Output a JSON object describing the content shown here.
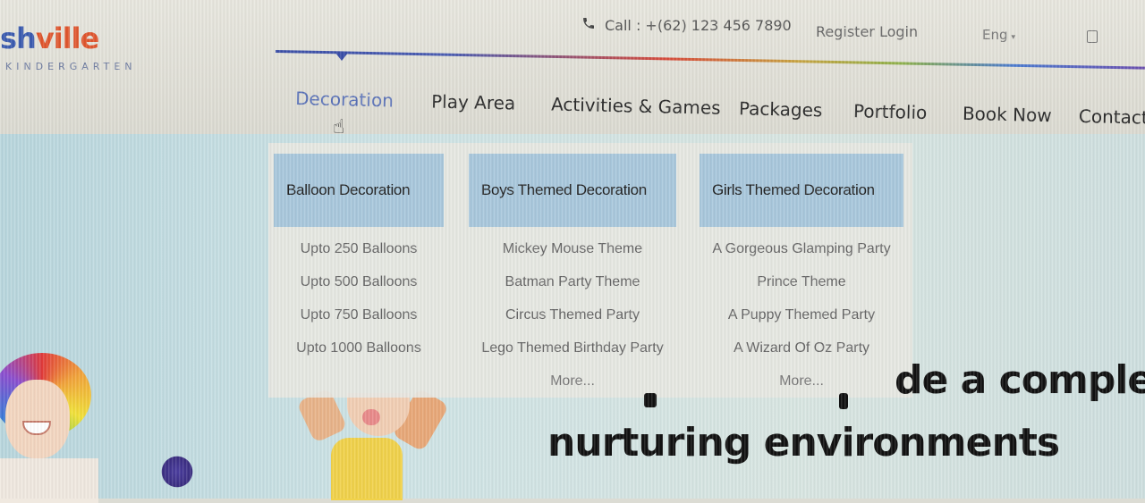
{
  "brand": {
    "logo_part1": "sh",
    "logo_part2": "ville",
    "tagline": "KINDERGARTEN",
    "colors": {
      "blue": "#3b5bb0",
      "orange": "#e0562e"
    }
  },
  "topbar": {
    "phone": "Call : +(62) 123 456 7890",
    "auth": "Register Login",
    "language": "Eng"
  },
  "nav": {
    "items": [
      "Decoration",
      "Play Area",
      "Activities & Games",
      "Packages",
      "Portfolio",
      "Book Now",
      "Contact"
    ],
    "active": "Decoration"
  },
  "mega_menu": {
    "columns": [
      {
        "heading": "Balloon Decoration",
        "links": [
          "Upto 250 Balloons",
          "Upto 500 Balloons",
          "Upto 750 Balloons",
          "Upto 1000 Balloons"
        ],
        "more": ""
      },
      {
        "heading": "Boys Themed Decoration",
        "links": [
          "Mickey Mouse Theme",
          "Batman Party Theme",
          "Circus Themed Party",
          "Lego Themed Birthday Party"
        ],
        "more": "More..."
      },
      {
        "heading": "Girls Themed Decoration",
        "links": [
          "A Gorgeous Glamping Party",
          "Prince Theme",
          "A Puppy Themed Party",
          "A Wizard Of Oz Party"
        ],
        "more": "More..."
      }
    ],
    "header_color": "#a9c8dd"
  },
  "hero": {
    "line1_tail": "de a complet",
    "line2": "nurturing environments"
  }
}
